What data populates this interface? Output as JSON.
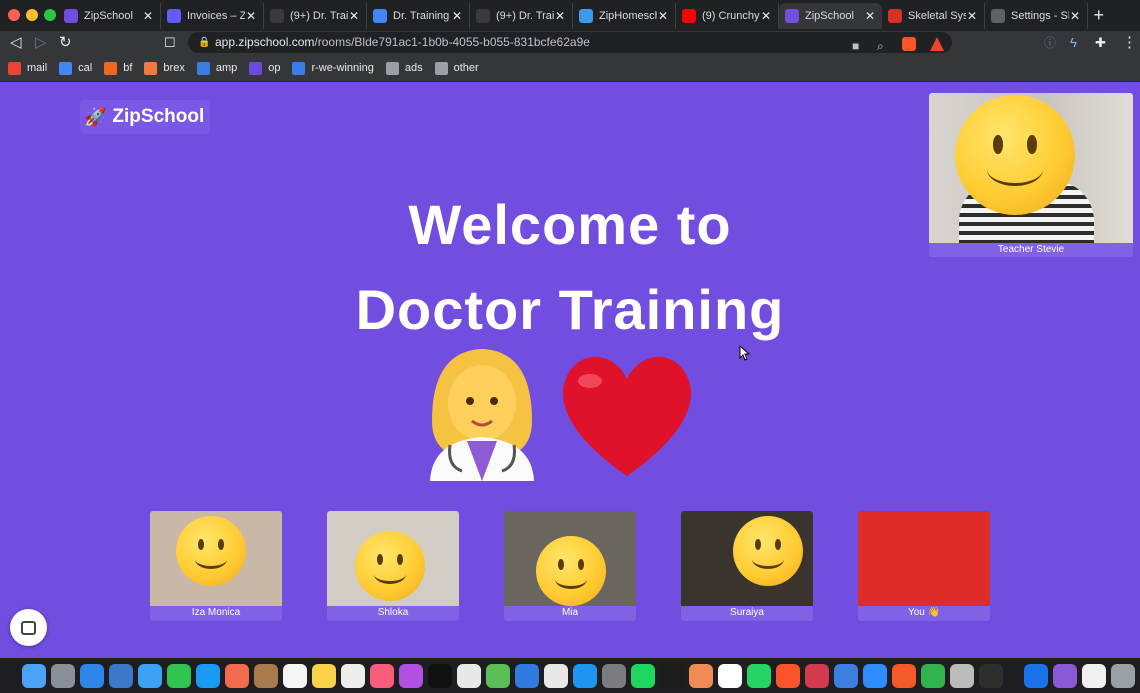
{
  "browser": {
    "tabs": [
      {
        "title": "ZipSchool",
        "favicon": "rocket-icon",
        "color": "#714ee0"
      },
      {
        "title": "Invoices – Zi",
        "favicon": "stripe-icon",
        "color": "#635bff"
      },
      {
        "title": "(9+) Dr. Trai",
        "favicon": "pencil-icon",
        "color": "#3a3a3a"
      },
      {
        "title": "Dr. Training l",
        "favicon": "docs-icon",
        "color": "#4285f4"
      },
      {
        "title": "(9+) Dr. Trai",
        "favicon": "pencil-icon",
        "color": "#3a3a3a"
      },
      {
        "title": "ZipHomesch",
        "favicon": "zip-icon",
        "color": "#3c9be8"
      },
      {
        "title": "(9) Crunchy",
        "favicon": "youtube-icon",
        "color": "#ff0000"
      },
      {
        "title": "ZipSchool",
        "favicon": "rocket-icon",
        "color": "#714ee0",
        "active": true
      },
      {
        "title": "Skeletal Syst",
        "favicon": "ruler-icon",
        "color": "#d93025"
      },
      {
        "title": "Settings - Sl",
        "favicon": "gear-icon",
        "color": "#5f6368"
      }
    ],
    "url_host": "app.zipschool.com",
    "url_path": "/rooms/Blde791ac1-1b0b-4055-b055-831bcfe62a9e",
    "bookmarks": [
      {
        "label": "mail",
        "icon": "gmail-icon",
        "color": "#ea4335"
      },
      {
        "label": "cal",
        "icon": "calendar-icon",
        "color": "#4285f4"
      },
      {
        "label": "bf",
        "icon": "ycombinator-icon",
        "color": "#f26522"
      },
      {
        "label": "brex",
        "icon": "brex-icon",
        "color": "#f27a3f"
      },
      {
        "label": "amp",
        "icon": "amp-icon",
        "color": "#3b7ce5"
      },
      {
        "label": "op",
        "icon": "op-icon",
        "color": "#6b4bdb"
      },
      {
        "label": "r-we-winning",
        "icon": "r-icon",
        "color": "#3b7ce5"
      },
      {
        "label": "ads",
        "icon": "ads-icon",
        "color": "#9aa0a6"
      },
      {
        "label": "other",
        "icon": "folder-icon",
        "color": "#9aa0a6"
      }
    ]
  },
  "app": {
    "logo_text": "ZipSchool",
    "headline_line1": "Welcome to",
    "headline_line2": "Doctor Training",
    "headline_emoji": "👩‍⚕️❤️",
    "teacher": {
      "name": "Teacher Stevie"
    },
    "students": [
      {
        "name": "Iza Monica",
        "bg": "#c9b7a7"
      },
      {
        "name": "Shloka",
        "bg": "#d2ccc4"
      },
      {
        "name": "Mia",
        "bg": "#6b6560"
      },
      {
        "name": "Suraiya",
        "bg": "#3a342e"
      },
      {
        "name": "You 👋",
        "bg": "#e02b2b"
      }
    ]
  }
}
